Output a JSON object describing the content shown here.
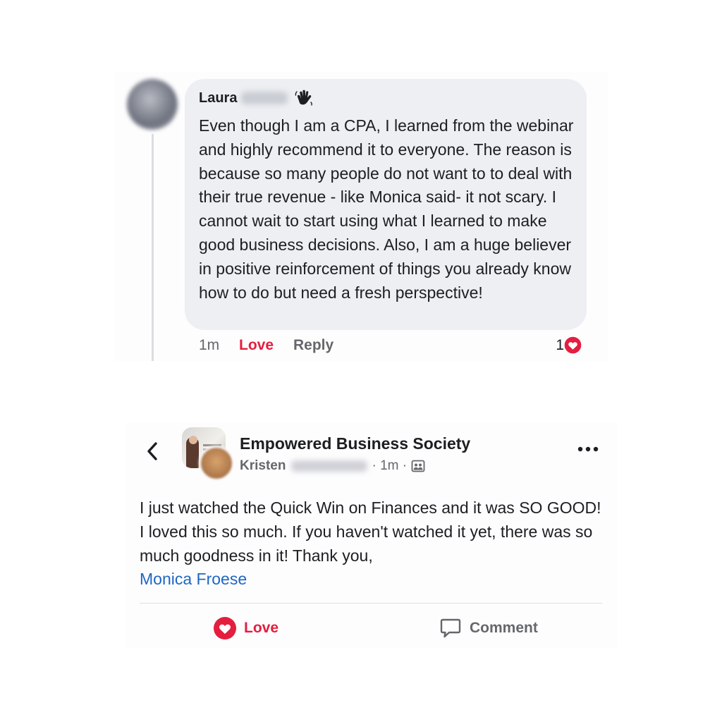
{
  "comment": {
    "author_first_name": "Laura",
    "author_last_name_blurred": "Lorie",
    "badge_icon": "waving-hand-icon",
    "text": "Even though I am a CPA, I learned from the webinar and highly recommend it to everyone. The reason is because so many people do not want to to deal with their true revenue - like Monica said- it not scary.  I cannot wait to start using what I learned to make good business decisions. Also, I am a huge believer in positive reinforcement of things you already know how to do but need a fresh perspective!",
    "time": "1m",
    "love_label": "Love",
    "reply_label": "Reply",
    "reaction_count": "1",
    "reaction_icon": "heart-icon"
  },
  "post": {
    "group_name": "Empowered Business Society",
    "author_first_name": "Kristen",
    "author_last_name_blurred": "Wilkinson",
    "time": "· 1m ·",
    "audience_icon": "group-members-icon",
    "text": "I just watched the Quick Win on Finances and it was SO GOOD! I loved this so much. If you haven't watched it yet, there was so much goodness in it! Thank you,",
    "mention": "Monica Froese",
    "love_label": "Love",
    "comment_label": "Comment"
  },
  "colors": {
    "love_red": "#e41e3f",
    "mention_blue": "#1f66c4",
    "meta_gray": "#65676b",
    "bubble_gray": "#eeeff3"
  }
}
